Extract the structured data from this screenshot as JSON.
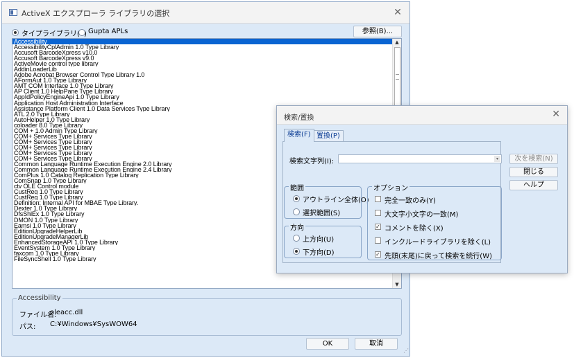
{
  "main": {
    "title": "ActiveX エクスプローラ ライブラリの選択",
    "radio_typelib": "タイプライブラリ(T)",
    "radio_gupta": "Gupta APLs",
    "browse_button": "参照(B)...",
    "libraries": [
      "Accessibility",
      "AccessibilityCplAdmin 1.0 Type Library",
      "Accusoft BarcodeXpress v10.0",
      "Accusoft BarcodeXpress v9.0",
      "ActiveMovie control type library",
      "AddinLoaderLib",
      "Adobe Acrobat Browser Control Type Library 1.0",
      "AFormAut 1.0 Type Library",
      "AMT COM Interface 1.0 Type Library",
      "AP Client 1.0 HelpPane Type Library",
      "AppIdPolicyEngineApi 1.0 Type Library",
      "Application Host Administration Interface",
      "Assistance Platform Client 1.0 Data Services Type Library",
      "ATL 2.0 Type Library",
      "AutoHelper 1.0 Type Library",
      "coloader 8.0 Type Library",
      "COM + 1.0 Admin Type Library",
      "COM+ Services Type Library",
      "COM+ Services Type Library",
      "COM+ Services Type Library",
      "COM+ Services Type Library",
      "COM+ Services Type Library",
      "Common Language Runtime Execution Engine 2.0 Library",
      "Common Language Runtime Execution Engine 2.4 Library",
      "ComPlus 1.0 Catalog Replication Type Library",
      "ComSnap 1.0 Type Library",
      "ctv OLE Control module",
      "CustReg 1.0 Type Library",
      "CustReg 1.0 Type Library",
      "Definition: Internal API for MBAE Type Library.",
      "Dexter 1.0 Type Library",
      "DfsShlEx 1.0 Type Library",
      "DMON 1.0 Type Library",
      "Eamsi 1.0 Type Library",
      "EditionUpgradeHelperLib",
      "EditionUpgradeManagerLib",
      "EnhancedStorageAPI 1.0 Type Library",
      "EventSystem 1.0 Type Library",
      "faxcom 1.0 Type Library",
      "FileSyncShell 1.0 Type Library"
    ],
    "info_group": "Accessibility",
    "file_label": "ファイル名:",
    "file_value": "oleacc.dll",
    "path_label": "パス:",
    "path_value": "C:¥Windows¥SysWOW64",
    "ok_button": "OK",
    "cancel_button": "取消"
  },
  "find": {
    "title": "検索/置換",
    "tab_search": "検索(F)",
    "tab_replace": "置換(P)",
    "search_label": "検索文字列(I):",
    "search_value": "",
    "find_next": "次を検索(N)",
    "close": "閉じる",
    "help": "ヘルプ",
    "range_group": "範囲",
    "range_outline": "アウトライン全体(O)",
    "range_selection": "選択範囲(S)",
    "direction_group": "方向",
    "direction_up": "上方向(U)",
    "direction_down": "下方向(D)",
    "options_group": "オプション",
    "opt_whole": "完全一致のみ(Y)",
    "opt_case": "大文字小文字の一致(M)",
    "opt_comments": "コメントを除く(X)",
    "opt_include": "インクルードライブラリを除く(L)",
    "opt_wrap": "先頭(末尾)に戻って検索を続行(W)"
  }
}
